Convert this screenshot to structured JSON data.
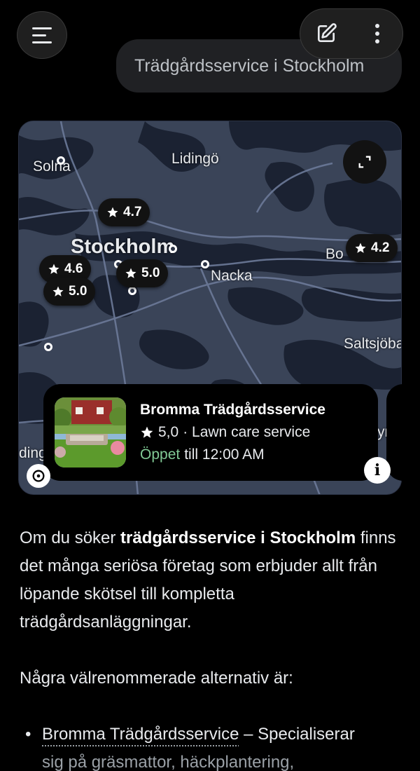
{
  "header": {
    "query": "Trädgårdsservice i Stockholm"
  },
  "map": {
    "places": {
      "solna": "Solna",
      "lidingo": "Lidingö",
      "stockholm": "Stockholm",
      "nacka": "Nacka",
      "bo": "Bo",
      "saltsjobaden": "Saltsjöba",
      "left_edge": "ding",
      "right_edge": "yr"
    },
    "pins": [
      {
        "rating": "4.7"
      },
      {
        "rating": "4.6"
      },
      {
        "rating": "5.0"
      },
      {
        "rating": "5.0"
      },
      {
        "rating": "4.2"
      }
    ]
  },
  "place_card": {
    "name": "Bromma Trädgårdsservice",
    "rating": "5,0",
    "category": "· Lawn care service",
    "status": "Öppet",
    "hours": "till 12:00 AM"
  },
  "answer": {
    "p1_a": "Om du söker ",
    "p1_bold": "trädgårdsservice i Stockholm",
    "p1_b": " finns det många seriösa företag som erbjuder allt från löpande skötsel till kompletta trädgårdsanläggningar.",
    "p2": "Några välrenommerade alternativ är:",
    "item1_link": "Bromma Trädgårdsservice",
    "item1_text": " – Specialiserar",
    "item1_faded": "sig på gräsmattor, häckplantering,"
  },
  "colors": {
    "open_status": "#81c995",
    "map_land": "#3a4458",
    "map_water": "#1b2232"
  }
}
